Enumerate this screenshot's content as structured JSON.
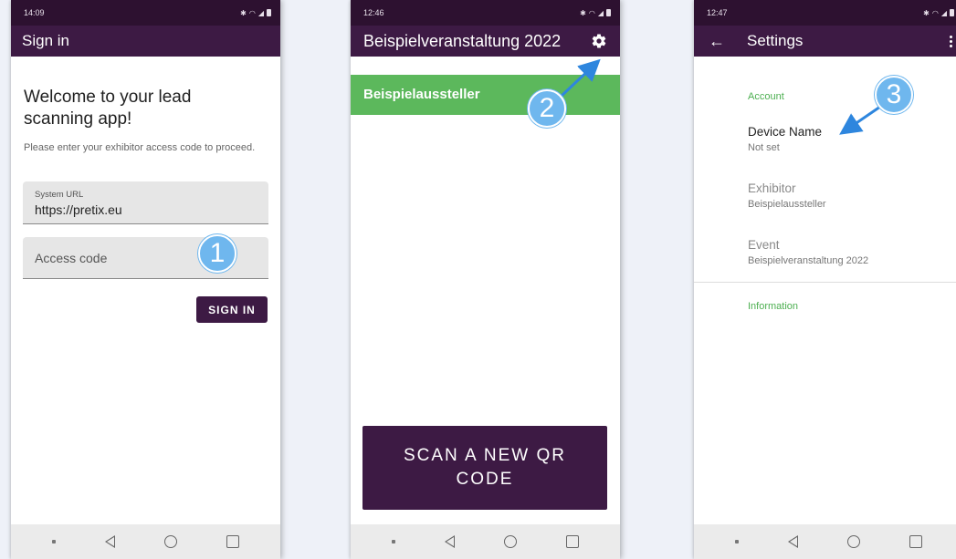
{
  "screens": [
    {
      "status_time": "14:09",
      "appbar_title": "Sign in",
      "welcome": "Welcome to your lead scanning app!",
      "instructions": "Please enter your exhibitor access code to proceed.",
      "system_url_label": "System URL",
      "system_url_value": "https://pretix.eu",
      "access_code_placeholder": "Access code",
      "signin_button": "SIGN IN"
    },
    {
      "status_time": "12:46",
      "appbar_title": "Beispielveranstaltung 2022",
      "settings_icon": "gear-icon",
      "exhibitor_name": "Beispielaussteller",
      "scan_button": "SCAN A NEW QR CODE"
    },
    {
      "status_time": "12:47",
      "appbar_title": "Settings",
      "back_icon": "back-arrow-icon",
      "category_account": "Account",
      "prefs": [
        {
          "title": "Device Name",
          "summary": "Not set"
        },
        {
          "title": "Exhibitor",
          "summary": "Beispielaussteller"
        },
        {
          "title": "Event",
          "summary": "Beispielveranstaltung 2022"
        }
      ],
      "category_information": "Information"
    }
  ],
  "callouts": [
    "1",
    "2",
    "3"
  ],
  "colors": {
    "primary": "#3d1a44",
    "status_bar": "#2d1130",
    "accent_green": "#5cb85c",
    "category_green": "#4caf50",
    "callout_blue": "#6fb7ee",
    "arrow_blue": "#2e86de"
  }
}
